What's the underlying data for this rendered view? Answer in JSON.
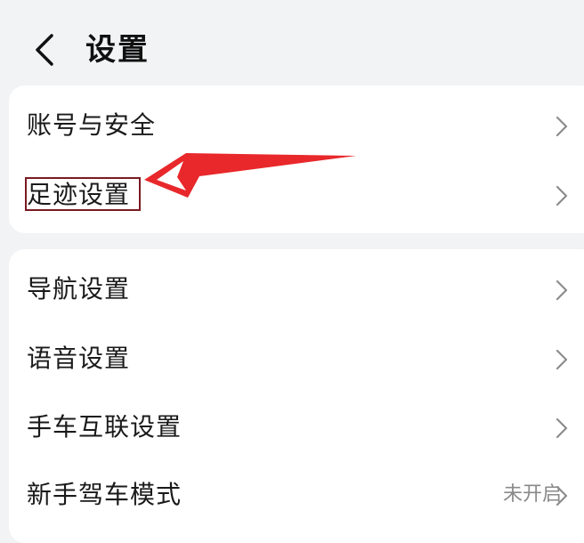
{
  "header": {
    "title": "设置"
  },
  "groups": [
    {
      "items": [
        {
          "label": "账号与安全"
        },
        {
          "label": "足迹设置"
        }
      ]
    },
    {
      "items": [
        {
          "label": "导航设置"
        },
        {
          "label": "语音设置"
        },
        {
          "label": "手车互联设置"
        },
        {
          "label": "新手驾车模式",
          "value": "未开启"
        }
      ]
    }
  ],
  "icons": {
    "back": "chevron-left-icon",
    "row": "chevron-right-icon"
  },
  "colors": {
    "background": "#f1f3f5",
    "card": "#ffffff",
    "text": "#1a1a1a",
    "chevron": "#8c8c8c",
    "annotation_arrow": "#e8282b",
    "annotation_box": "#7a1a22"
  }
}
